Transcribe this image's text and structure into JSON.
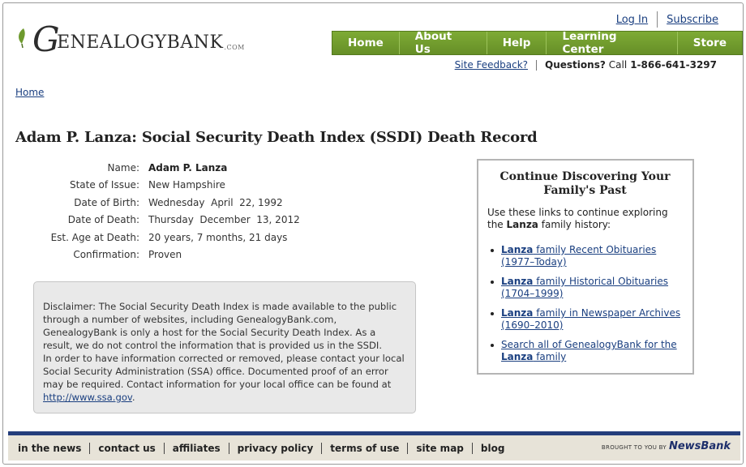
{
  "brand": {
    "logo_initial": "G",
    "logo_rest": "ENEALOGYBANK",
    "logo_suffix": ".COM"
  },
  "top_links": {
    "login": "Log In",
    "subscribe": "Subscribe"
  },
  "nav": [
    {
      "label": "Home"
    },
    {
      "label": "About Us"
    },
    {
      "label": "Help"
    },
    {
      "label": "Learning Center"
    },
    {
      "label": "Store"
    }
  ],
  "contact": {
    "feedback": "Site Feedback?",
    "questions": "Questions?",
    "call": "Call",
    "phone": "1-866-641-3297"
  },
  "breadcrumb": {
    "home": "Home"
  },
  "page_title": "Adam P. Lanza: Social Security Death Index (SSDI) Death Record",
  "record": [
    {
      "label": "Name:",
      "value": "Adam P. Lanza"
    },
    {
      "label": "State of Issue:",
      "value": "New Hampshire"
    },
    {
      "label": "Date of Birth:",
      "value": "Wednesday  April  22, 1992"
    },
    {
      "label": "Date of Death:",
      "value": "Thursday  December  13, 2012"
    },
    {
      "label": "Est. Age at Death:",
      "value": "20 years, 7 months, 21 days"
    },
    {
      "label": "Confirmation:",
      "value": "Proven"
    }
  ],
  "disclaimer": {
    "paragraph1": "Disclaimer: The Social Security Death Index is made available to the public through a number of websites, including GenealogyBank.com, GenealogyBank is only a host for the Social Security Death Index. As a result, we do not control the information that is provided us in the SSDI.",
    "paragraph2": "In order to have information corrected or removed, please contact your local Social Security Administration (SSA) office. Documented proof of an error may be required. Contact information for your local office can be found at",
    "link": "http://www.ssa.gov",
    "link_suffix": "."
  },
  "sidebox": {
    "title": "Continue Discovering Your Family's Past",
    "intro_before": "Use these links to continue exploring the",
    "intro_name": "Lanza",
    "intro_after": "family history:",
    "links": [
      {
        "bold": "Lanza",
        "text": " family Recent Obituaries (1977–Today)"
      },
      {
        "bold": "Lanza",
        "text": " family Historical Obituaries (1704–1999)"
      },
      {
        "bold": "Lanza",
        "text": " family in Newspaper Archives (1690–2010)"
      },
      {
        "pre": "Search all of GenealogyBank for the ",
        "bold": "Lanza",
        "text": " family"
      }
    ]
  },
  "footer": {
    "links": [
      "in the news",
      "contact us",
      "affiliates",
      "privacy policy",
      "terms of use",
      "site map",
      "blog"
    ],
    "brought_by": "BROUGHT TO YOU BY",
    "newsbank": "NewsBank"
  }
}
